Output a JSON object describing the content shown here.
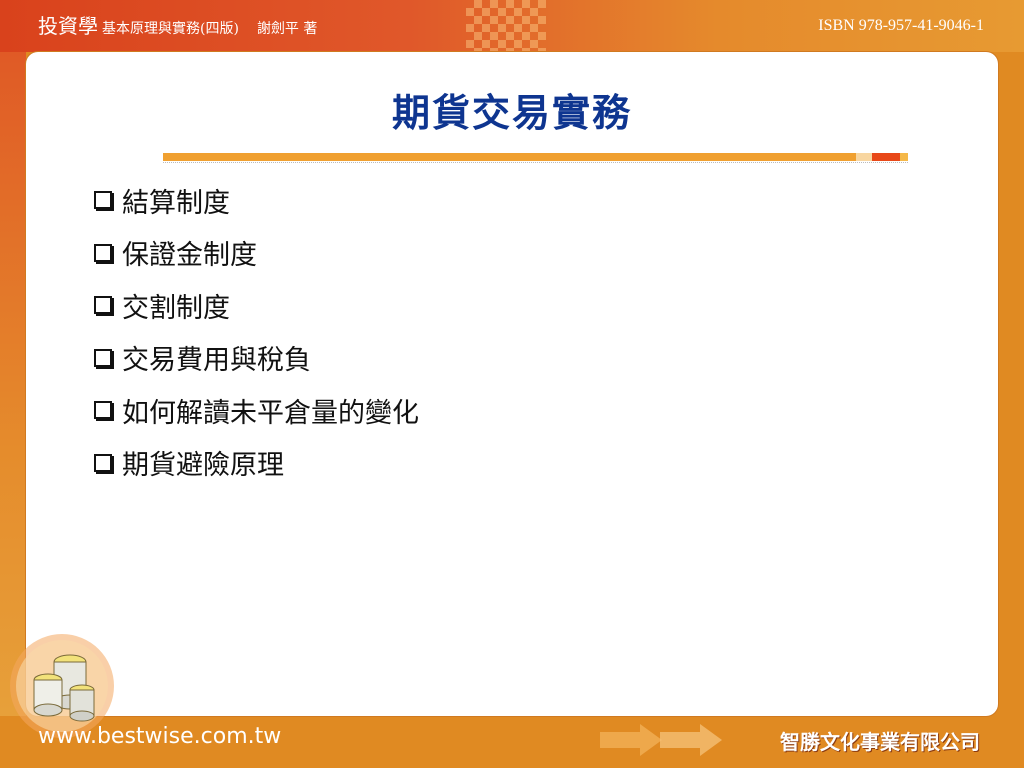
{
  "header": {
    "book_title": "投資學",
    "book_subtitle": "基本原理與實務(四版)",
    "author": "謝劍平 著",
    "isbn": "ISBN 978-957-41-9046-1"
  },
  "slide": {
    "title": "期貨交易實務",
    "bullets": [
      "結算制度",
      "保證金制度",
      "交割制度",
      "交易費用與稅負",
      "如何解讀未平倉量的變化",
      "期貨避險原理"
    ]
  },
  "footer": {
    "website": "www.bestwise.com.tw",
    "publisher": "智勝文化事業有限公司"
  },
  "icons": {
    "bullet": "checkbox-bullet-icon",
    "logo": "coin-stack-icon",
    "arrows": "forward-arrows-icon"
  },
  "colors": {
    "title": "#0e3590",
    "accent": "#e08a22",
    "header": "#d9421c"
  }
}
